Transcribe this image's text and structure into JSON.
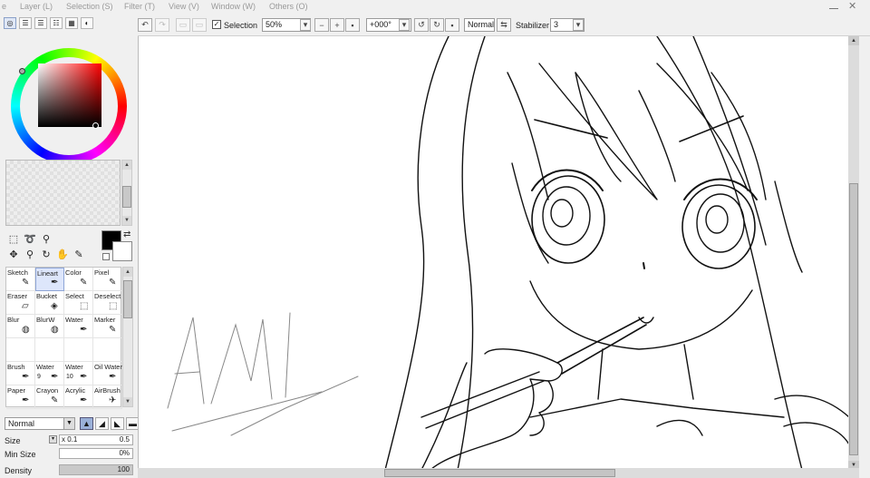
{
  "menu": {
    "items": [
      "Layer (L)",
      "Selection (S)",
      "Filter (T)",
      "View (V)",
      "Window (W)",
      "Others (O)"
    ],
    "partial_left": "e"
  },
  "toolbar": {
    "selection_label": "Selection",
    "selection_checked": true,
    "zoom": "50%",
    "rotation": "+000°",
    "blend_mode": "Normal",
    "stabilizer_label": "Stabilizer",
    "stabilizer_value": "3"
  },
  "color": {
    "foreground": "#000000",
    "background": "#ffffff",
    "selected_hue": "#ff0000"
  },
  "brushes": [
    {
      "name": "Sketch",
      "size": "",
      "icon": "pencil-icon"
    },
    {
      "name": "Lineart",
      "size": "",
      "icon": "pen-icon",
      "selected": true
    },
    {
      "name": "Color",
      "size": "",
      "icon": "pencil-icon"
    },
    {
      "name": "Pixel",
      "size": "",
      "icon": "pencil-icon"
    },
    {
      "name": "Eraser",
      "size": "",
      "icon": "eraser-icon"
    },
    {
      "name": "Bucket",
      "size": "",
      "icon": "bucket-icon"
    },
    {
      "name": "Select",
      "size": "",
      "icon": "select-icon"
    },
    {
      "name": "Deselect",
      "size": "",
      "icon": "deselect-icon"
    },
    {
      "name": "Blur",
      "size": "",
      "icon": "blur-icon"
    },
    {
      "name": "BlurW",
      "size": "",
      "icon": "blur-icon"
    },
    {
      "name": "Water",
      "size": "",
      "icon": "water-icon"
    },
    {
      "name": "Marker",
      "size": "",
      "icon": "marker-icon"
    },
    {
      "name": "",
      "size": "",
      "icon": ""
    },
    {
      "name": "",
      "size": "",
      "icon": ""
    },
    {
      "name": "",
      "size": "",
      "icon": ""
    },
    {
      "name": "",
      "size": "",
      "icon": ""
    },
    {
      "name": "Brush",
      "size": "",
      "icon": "brush-icon"
    },
    {
      "name": "Water",
      "size": "9",
      "icon": "water-icon"
    },
    {
      "name": "Water",
      "size": "10",
      "icon": "water-icon"
    },
    {
      "name": "Oil Water",
      "size": "",
      "icon": "brush-icon"
    },
    {
      "name": "Paper",
      "size": "",
      "icon": "brush-icon"
    },
    {
      "name": "Crayon",
      "size": "",
      "icon": "crayon-icon"
    },
    {
      "name": "Acrylic",
      "size": "",
      "icon": "brush-icon"
    },
    {
      "name": "AirBrush",
      "size": "",
      "icon": "airbrush-icon"
    }
  ],
  "brush_props": {
    "blend": "Normal",
    "size_label": "Size",
    "size_multiplier": "x 0.1",
    "size_value": "0.5",
    "min_size_label": "Min Size",
    "min_size_value": "0%",
    "min_size_fraction": 0.0,
    "density_label": "Density",
    "density_value": "100",
    "density_fraction": 1.0
  },
  "canvas": {
    "scroll_vertical_fraction": 0.4,
    "scroll_horizontal_fraction": 0.35
  }
}
